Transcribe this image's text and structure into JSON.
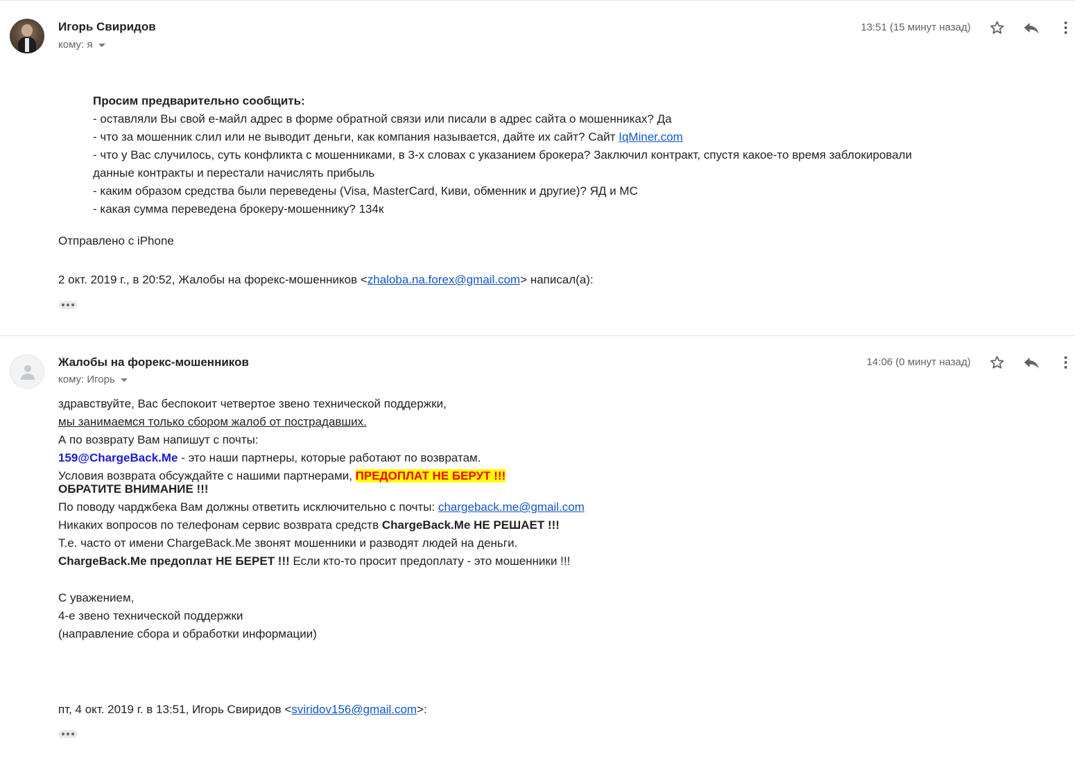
{
  "messages": [
    {
      "sender": "Игорь Свиридов",
      "to_label": "кому: я",
      "time": "13:51 (15 минут назад)",
      "icons": {
        "star": "star-icon",
        "reply": "reply-icon",
        "more": "more-vert-icon"
      },
      "body": {
        "heading": "Просим предварительно сообщить:",
        "q1": " - оставляли Вы свой е-майл адрес в форме обратной связи или писали в адрес сайта о мошенниках? Да",
        "q2_text": " - что за мошенник слил или не выводит деньги, как компания называется, дайте их сайт? Сайт ",
        "q2_link": "IqMiner.com",
        "q3_line1": "- что у Вас случилось, суть конфликта с мошенниками, в 3-х словах с указанием брокера? Заключил контракт, спустя какое-то время заблокировали",
        "q3_line2": "данные контракты и перестали начислять прибыль",
        "q4": " - каким образом средства были переведены (Visa, MasterCard, Киви, обменник и другие)? ЯД и МС",
        "q5": " - какая сумма переведена брокеру-мошеннику? 134к",
        "signature": "Отправлено с iPhone",
        "quote_prefix": "2 окт. 2019 г., в 20:52, Жалобы на форекс-мошенников <",
        "quote_email": "zhaloba.na.forex@gmail.com",
        "quote_suffix": "> написал(а):"
      }
    },
    {
      "sender": "Жалобы на форекс-мошенников",
      "to_label": "кому: Игорь",
      "time": "14:06 (0 минут назад)",
      "icons": {
        "star": "star-icon",
        "reply": "reply-icon",
        "more": "more-vert-icon"
      },
      "body": {
        "l1": "здравствуйте, Вас беспокоит четвертое звено технической поддержки,",
        "l2": "мы занимаемся только сбором жалоб от пострадавших.",
        "l3": "А по возврату Вам напишут с почты:",
        "l4_email": "159@ChargeBack.Me",
        "l4_text": " - это наши партнеры, которые работают по возвратам.",
        "l5_text": "Условия возврата обсуждайте с нашими партнерами, ",
        "l5_highlight": "ПРЕДОПЛАТ НЕ БЕРУТ !!!",
        "l6": "ОБРАТИТЕ ВНИМАНИЕ !!!",
        "l7_text": "По поводу чарджбека Вам должны ответить исключительно с почты: ",
        "l7_link": "chargeback.me@gmail.com",
        "l8_text": "Никаких вопросов по телефонам сервис возврата средств ",
        "l8_bold": "ChargeBack.Me НЕ РЕШАЕТ !!!",
        "l9": "Т.е. часто от имени ChargeBack.Me звонят мошенники и разводят людей на деньги.",
        "l10_bold": "ChargeBack.Me предоплат НЕ БЕРЕТ !!!",
        "l10_text": " Если кто-то просит предоплату - это мошенники !!!",
        "sig1": "С уважением,",
        "sig2": "4-е звено технической поддержки",
        "sig3": "(направление сбора и обработки информации)",
        "quote_prefix": "пт, 4 окт. 2019 г. в 13:51, Игорь Свиридов <",
        "quote_email": "sviridov156@gmail.com",
        "quote_suffix": ">:"
      }
    }
  ]
}
